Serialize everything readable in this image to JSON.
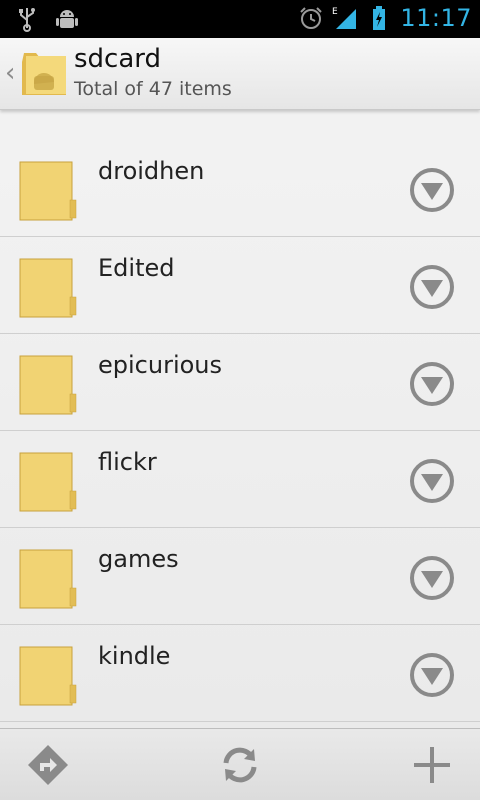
{
  "status_bar": {
    "time": "11:17",
    "left_icons": [
      "usb-icon",
      "android-debug-icon"
    ],
    "right_icons": [
      "alarm-icon",
      "signal-e-icon",
      "battery-charging-icon"
    ],
    "accent": "#33b5e5"
  },
  "header": {
    "title": "sdcard",
    "subtitle": "Total of 47 items",
    "up_glyph": "‹"
  },
  "list": {
    "items": [
      {
        "label": ""
      },
      {
        "label": "droidhen"
      },
      {
        "label": "Edited"
      },
      {
        "label": "epicurious"
      },
      {
        "label": "flickr"
      },
      {
        "label": "games"
      },
      {
        "label": "kindle"
      },
      {
        "label": ""
      }
    ]
  },
  "toolbar": {
    "buttons": [
      "directions-icon",
      "refresh-icon",
      "add-icon"
    ]
  },
  "colors": {
    "folder": "#f1d373",
    "icon_gray": "#8a8a8a",
    "status_blue": "#33b5e5"
  }
}
